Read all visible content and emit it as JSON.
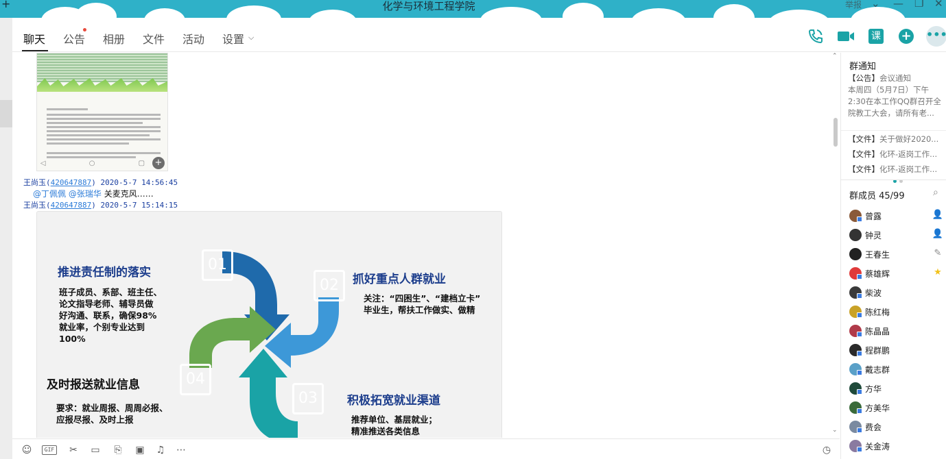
{
  "window": {
    "title": "化学与环境工程学院",
    "report_label": "举报",
    "min_label": "—",
    "restore_label": "❐",
    "close_label": "✕",
    "plus_label": "+"
  },
  "tabs": [
    {
      "label": "聊天"
    },
    {
      "label": "公告"
    },
    {
      "label": "相册"
    },
    {
      "label": "文件"
    },
    {
      "label": "活动"
    },
    {
      "label": "设置"
    }
  ],
  "toolbar_icons": [
    "phone-icon",
    "video-call-icon",
    "class-icon",
    "add-icon",
    "more-icon"
  ],
  "class_icon_text": "课",
  "messages": [
    {
      "sender": "王尚玉",
      "qq": "420647887",
      "time": "2020-5-7 14:56:45"
    },
    {
      "mention1": "@丁佩佩",
      "mention2": "@张瑞华",
      "text": "关麦克风……"
    },
    {
      "sender": "王尚玉",
      "qq": "420647887",
      "time": "2020-5-7 15:14:15"
    }
  ],
  "image_thumb": {
    "nav": "◁ ○ ▢",
    "zoom": "+"
  },
  "infographic": {
    "colors": {
      "c01": "#1f6aab",
      "c02": "#3d98d8",
      "c03": "#1aa3a6",
      "c04": "#6aa84f"
    },
    "num01": "01",
    "num02": "02",
    "num03": "03",
    "num04": "04",
    "h01": "推进责任制的落实",
    "b01": [
      "班子成员、系部、班主任、",
      "论文指导老师、辅导员做",
      "好沟通、联系，确保98%",
      "就业率，个别专业达到",
      "100%"
    ],
    "h02": "抓好重点人群就业",
    "b02": [
      "关注：“四困生”、“建档立卡”",
      "毕业生，帮扶工作做实、做精"
    ],
    "h03": "积极拓宽就业渠道",
    "b03": [
      "推荐单位、基层就业；",
      "精准推送各类信息"
    ],
    "h04": "及时报送就业信息",
    "b04": [
      "要求：就业周报、周周必报、",
      "应报尽报、及时上报"
    ]
  },
  "bottom_toolbar": {
    "gif": "GIF",
    "icons": [
      "emoji-icon",
      "gif-icon",
      "scissors-icon",
      "folder-icon",
      "file-icon",
      "image-icon",
      "bell-off-icon",
      "more-icon",
      "history-icon"
    ]
  },
  "right_panel": {
    "notice_title": "群通知",
    "notice_lines": [
      {
        "tag": "【公告】",
        "text": "会议通知"
      },
      {
        "tag": "",
        "text": "本周四（5月7日）下午"
      },
      {
        "tag": "",
        "text": "2:30在本工作QQ群召开全"
      },
      {
        "tag": "",
        "text": "院教工大会，请所有老..."
      }
    ],
    "files": [
      {
        "tag": "【文件】",
        "text": "关于做好2020..."
      },
      {
        "tag": "【文件】",
        "text": "化环-返岗工作..."
      },
      {
        "tag": "【文件】",
        "text": "化环-返岗工作..."
      }
    ],
    "members_title": "群成员 45/99",
    "members": [
      {
        "name": "曾露",
        "avatar": "#8a5a3a",
        "badge": true,
        "right_icon": "person-icon",
        "right_glyph": "👤",
        "right_color": "#e8943a"
      },
      {
        "name": "钟灵",
        "avatar": "#333333",
        "badge": false,
        "right_icon": "person-icon",
        "right_glyph": "👤",
        "right_color": "#4caf50"
      },
      {
        "name": "王春生",
        "avatar": "#222222",
        "badge": false,
        "right_icon": "edit-icon",
        "right_glyph": "✎",
        "right_color": "#888888"
      },
      {
        "name": "蔡雄辉",
        "avatar": "#e03a3a",
        "badge": true,
        "right_icon": "star-icon",
        "right_glyph": "★",
        "right_color": "#f2c21b"
      },
      {
        "name": "柴波",
        "avatar": "#3a3a3a",
        "badge": true,
        "right_icon": "",
        "right_glyph": "",
        "right_color": ""
      },
      {
        "name": "陈红梅",
        "avatar": "#c9a227",
        "badge": true,
        "right_icon": "",
        "right_glyph": "",
        "right_color": ""
      },
      {
        "name": "陈晶晶",
        "avatar": "#b03a4a",
        "badge": true,
        "right_icon": "",
        "right_glyph": "",
        "right_color": ""
      },
      {
        "name": "程群鹏",
        "avatar": "#2a2a2a",
        "badge": true,
        "right_icon": "",
        "right_glyph": "",
        "right_color": ""
      },
      {
        "name": "戴志群",
        "avatar": "#5aa0c8",
        "badge": true,
        "right_icon": "",
        "right_glyph": "",
        "right_color": ""
      },
      {
        "name": "方华",
        "avatar": "#1f4a3a",
        "badge": true,
        "right_icon": "",
        "right_glyph": "",
        "right_color": ""
      },
      {
        "name": "方美华",
        "avatar": "#3a6a3a",
        "badge": true,
        "right_icon": "",
        "right_glyph": "",
        "right_color": ""
      },
      {
        "name": "费会",
        "avatar": "#7a8aa0",
        "badge": true,
        "right_icon": "",
        "right_glyph": "",
        "right_color": ""
      },
      {
        "name": "关金涛",
        "avatar": "#8a7aa0",
        "badge": true,
        "right_icon": "",
        "right_glyph": "",
        "right_color": ""
      }
    ]
  }
}
